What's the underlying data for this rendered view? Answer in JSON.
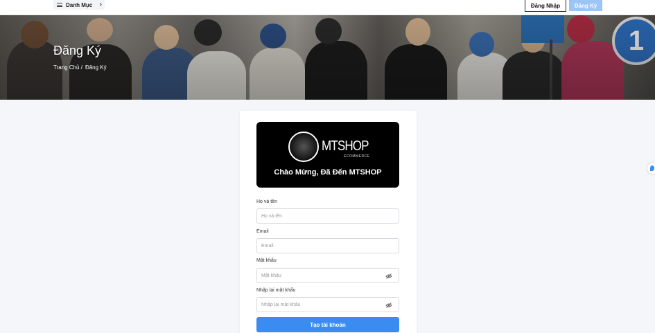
{
  "header": {
    "menu_label": "Danh Mục",
    "login_label": "Đăng Nhập",
    "register_label": "Đăng Ký"
  },
  "hero": {
    "title": "Đăng Ký",
    "breadcrumb": [
      "Trang Chủ /",
      "Đăng Ký"
    ],
    "sign_number": "1"
  },
  "brand": {
    "logo_text": "MTSHOP",
    "logo_subtext": "ECOMMERCE",
    "welcome": "Chào Mừng, Đã Đến MTSHOP"
  },
  "form": {
    "fields": [
      {
        "label": "Họ và tên",
        "placeholder": "Họ và tên",
        "value": ""
      },
      {
        "label": "Email",
        "placeholder": "Email",
        "value": ""
      },
      {
        "label": "Mật khẩu",
        "placeholder": "Mật khẩu",
        "value": ""
      },
      {
        "label": "Nhập lại mật khẩu",
        "placeholder": "Nhập lại mật khẩu",
        "value": ""
      }
    ],
    "submit_label": "Tạo tài khoản"
  },
  "colors": {
    "primary": "#3b8cf0",
    "register_button": "#9cc4f7",
    "brand_bg": "#000000",
    "page_bg": "#f4f6f9"
  }
}
